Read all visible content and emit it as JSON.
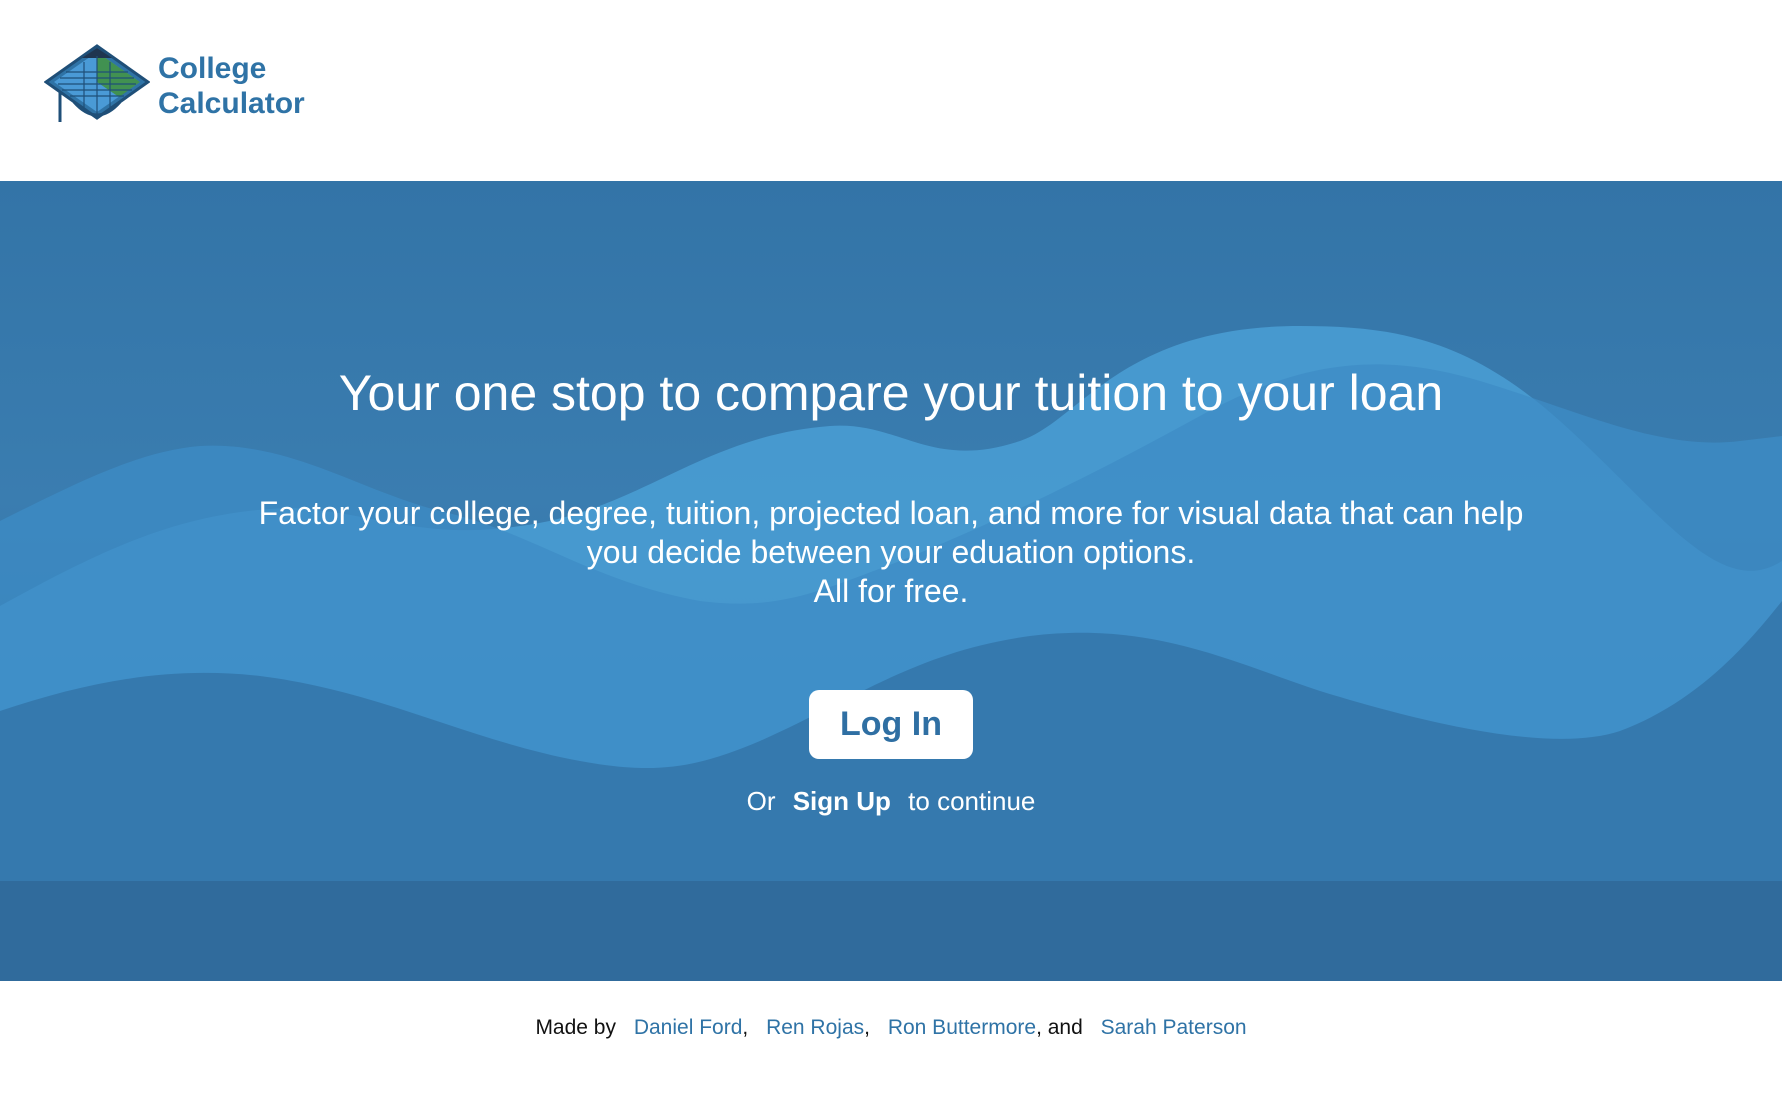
{
  "brand": {
    "name_line1": "College",
    "name_line2": "Calculator",
    "logo_icon": "graduation-cap-calculator-icon",
    "color": "#2f73a6"
  },
  "hero": {
    "title": "Your one stop to compare your tuition to your loan",
    "subtitle_line1": "Factor your college, degree, tuition, projected loan, and more for visual data that can help",
    "subtitle_line2": "you decide between your eduation options.",
    "subtitle_line3": "All for free.",
    "login_label": "Log In",
    "or_text": "Or",
    "signup_label": "Sign Up",
    "continue_text": "to continue",
    "background_color": "#3374a7"
  },
  "footer": {
    "made_by": "Made by",
    "authors": [
      "Daniel Ford",
      "Ren Rojas",
      "Ron Buttermore",
      "Sarah Paterson"
    ],
    "separator1": ",",
    "separator2": ",",
    "separator3": ", and",
    "link_color": "#2f73a6"
  }
}
